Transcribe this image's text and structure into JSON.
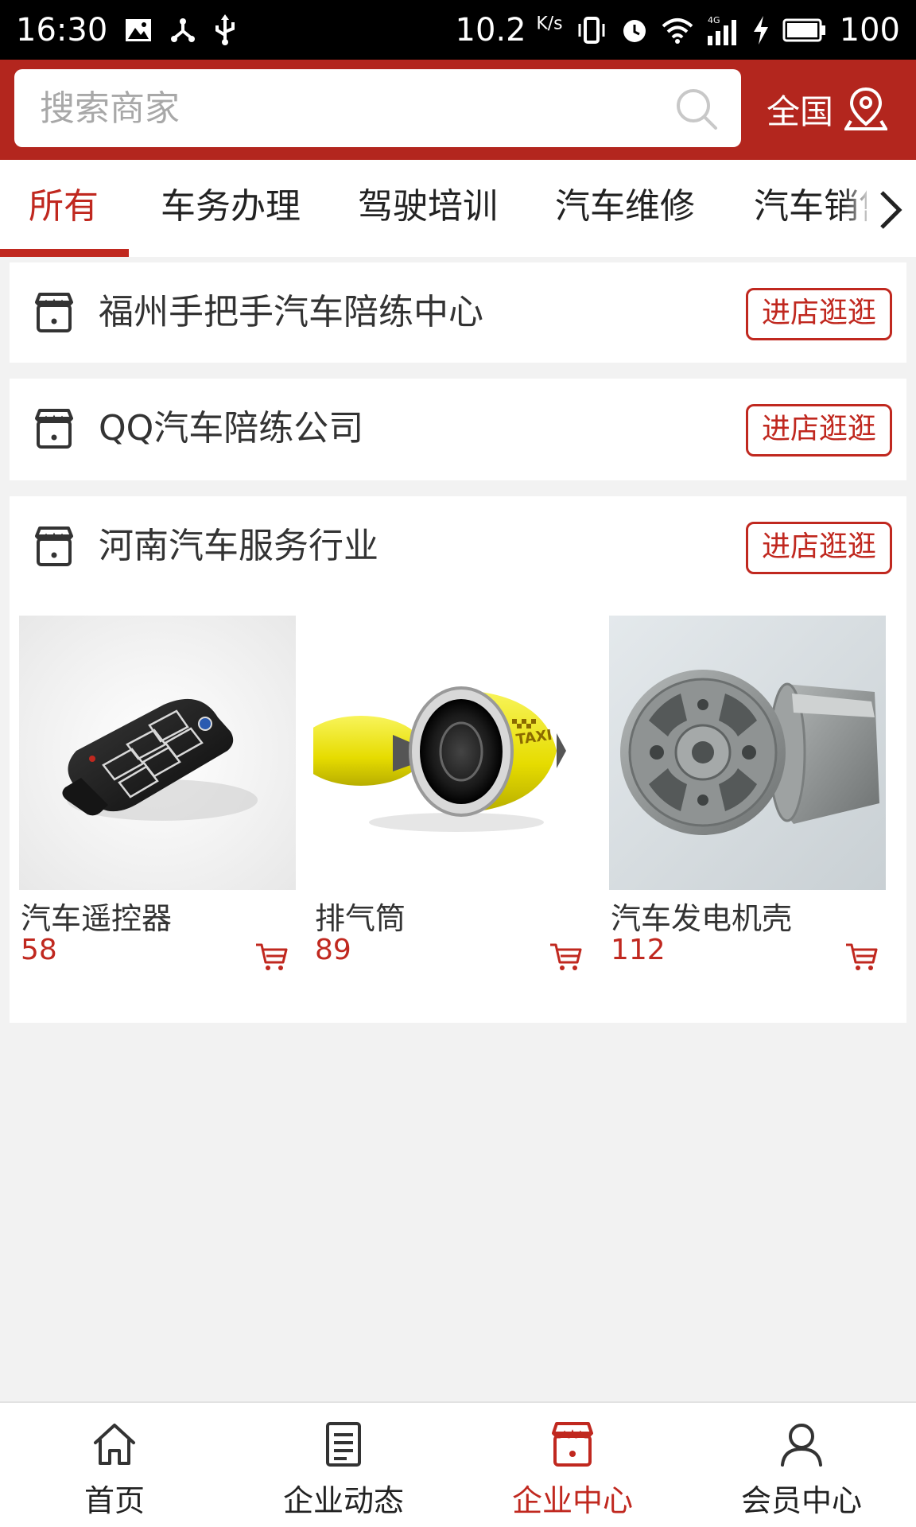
{
  "status_bar": {
    "time": "16:30",
    "speed": "10.2",
    "speed_unit": "K/s",
    "network": "4G",
    "battery": "100"
  },
  "header": {
    "search_placeholder": "搜索商家",
    "region_label": "全国"
  },
  "tabs": [
    {
      "label": "所有",
      "active": true
    },
    {
      "label": "车务办理",
      "active": false
    },
    {
      "label": "驾驶培训",
      "active": false
    },
    {
      "label": "汽车维修",
      "active": false
    },
    {
      "label": "汽车销售",
      "active": false
    }
  ],
  "stores": [
    {
      "name": "福州手把手汽车陪练中心",
      "button": "进店逛逛",
      "products": []
    },
    {
      "name": "QQ汽车陪练公司",
      "button": "进店逛逛",
      "products": []
    },
    {
      "name": "河南汽车服务行业",
      "button": "进店逛逛",
      "products": [
        {
          "name": "汽车遥控器",
          "price": "58"
        },
        {
          "name": "排气筒",
          "price": "89"
        },
        {
          "name": "汽车发电机壳",
          "price": "112"
        }
      ]
    }
  ],
  "bottom_nav": [
    {
      "label": "首页",
      "icon": "home-icon",
      "active": false
    },
    {
      "label": "企业动态",
      "icon": "news-icon",
      "active": false
    },
    {
      "label": "企业中心",
      "icon": "store-icon",
      "active": true
    },
    {
      "label": "会员中心",
      "icon": "user-icon",
      "active": false
    }
  ],
  "colors": {
    "brand": "#b3261e",
    "accent": "#c0281f",
    "background": "#f2f2f2"
  }
}
